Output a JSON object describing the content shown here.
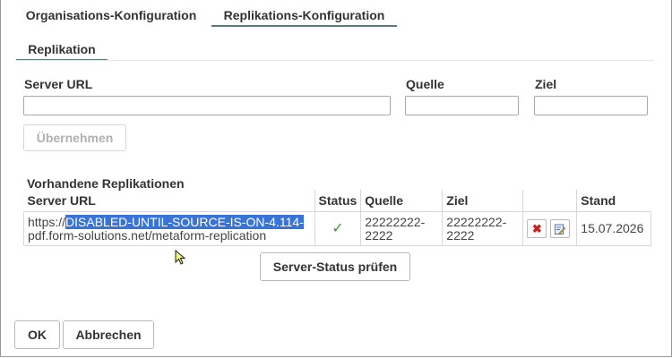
{
  "tabs": [
    {
      "label": "Organisations-Konfiguration",
      "active": false
    },
    {
      "label": "Replikations-Konfiguration",
      "active": true
    }
  ],
  "subtab": {
    "label": "Replikation"
  },
  "form": {
    "server_url_label": "Server URL",
    "source_label": "Quelle",
    "target_label": "Ziel",
    "server_url_value": "",
    "source_value": "",
    "target_value": "",
    "apply_button": "Übernehmen"
  },
  "existing": {
    "title": "Vorhandene Replikationen",
    "columns": [
      "Server URL",
      "Status",
      "Quelle",
      "Ziel",
      "",
      "Stand"
    ],
    "rows": [
      {
        "url_prefix": "https://",
        "url_selected": "DISABLED-UNTIL-SOURCE-IS-ON-4.114-",
        "url_rest": "pdf.form-solutions.net/metaform-replication",
        "status_icon": "check-icon",
        "source": "22222222-2222",
        "source_line1": "22222222-",
        "source_line2": "2222",
        "target_line1": "22222222-",
        "target_line2": "2222",
        "date": "15.07.2026"
      }
    ],
    "check_button": "Server-Status prüfen"
  },
  "footer": {
    "ok": "OK",
    "cancel": "Abbrechen"
  },
  "colors": {
    "accent_underline": "#5a7a82",
    "selection": "#3874d8",
    "delete": "#cc1f1f",
    "status_ok": "#3a9a3a"
  }
}
